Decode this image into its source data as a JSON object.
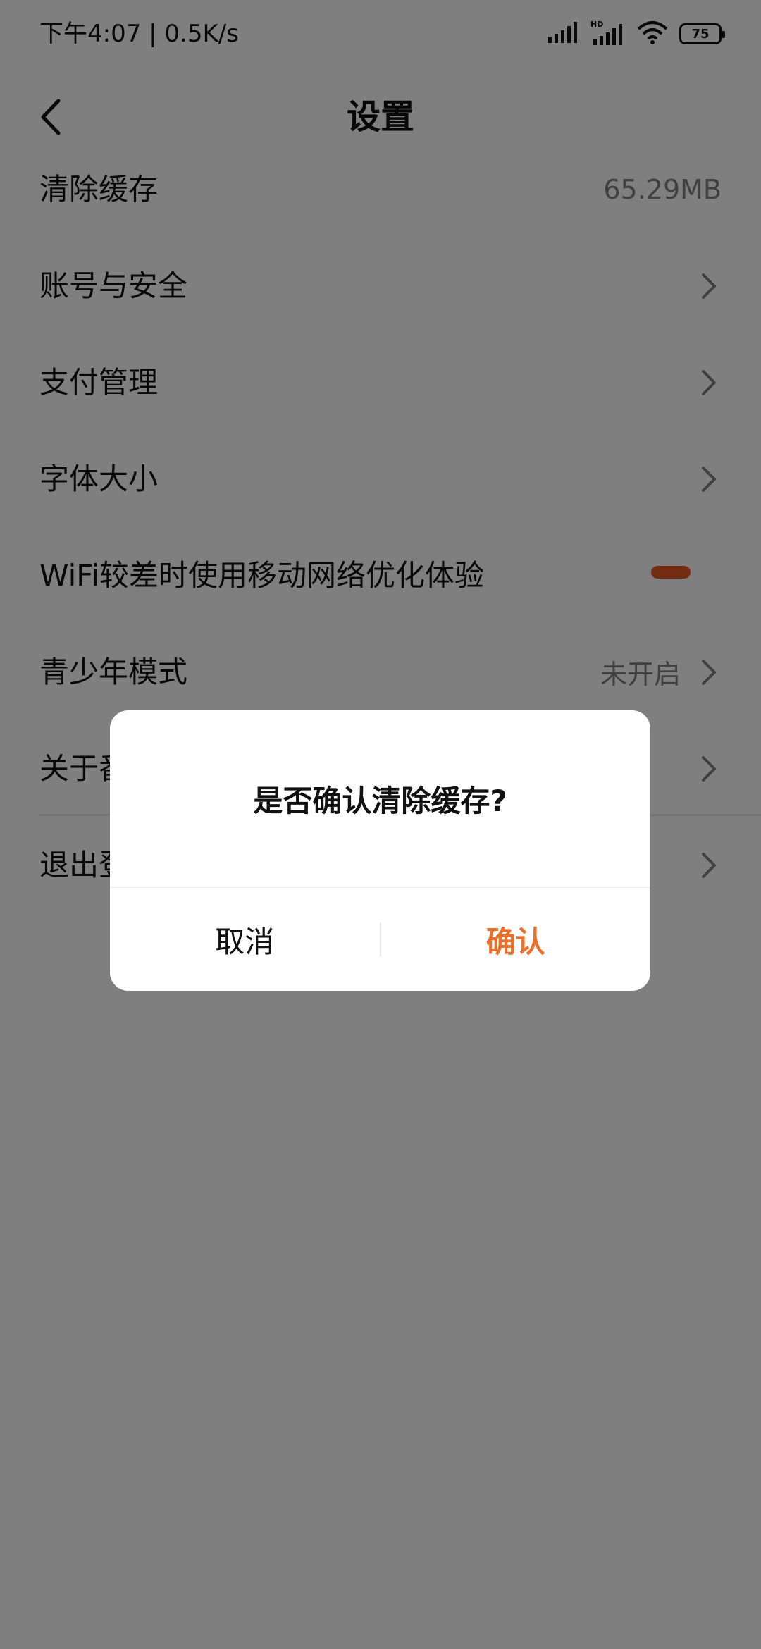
{
  "status_bar": {
    "time": "下午4:07 | 0.5K/s",
    "battery": "75",
    "icons": [
      "signal-icon",
      "hd-signal-icon",
      "wifi-icon",
      "battery-icon"
    ]
  },
  "header": {
    "title": "设置",
    "back_icon": "chevron-left-icon"
  },
  "settings": [
    {
      "label": "清除缓存",
      "value": "65.29MB",
      "chevron": false
    },
    {
      "label": "账号与安全",
      "value": "",
      "chevron": true
    },
    {
      "label": "支付管理",
      "value": "",
      "chevron": true
    },
    {
      "label": "字体大小",
      "value": "",
      "chevron": true
    },
    {
      "label": "WiFi较差时使用移动网络优化体验",
      "toggle": true
    },
    {
      "label": "青少年模式",
      "value": "未开启",
      "chevron": true
    },
    {
      "label": "关于番",
      "value": "",
      "chevron": true
    },
    {
      "label": "退出登",
      "value": "",
      "chevron": true
    }
  ],
  "dialog": {
    "message": "是否确认清除缓存?",
    "cancel": "取消",
    "confirm": "确认"
  },
  "colors": {
    "accent": "#e8702a",
    "toggle_on": "#e85a24",
    "overlay": "rgba(0,0,0,0.5)"
  }
}
